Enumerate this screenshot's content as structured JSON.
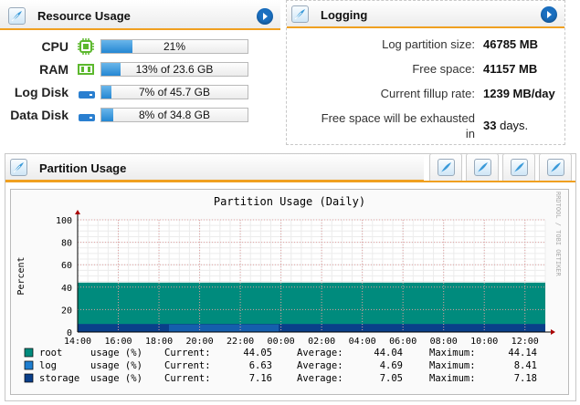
{
  "resource": {
    "title": "Resource Usage",
    "rows": [
      {
        "label": "CPU",
        "icon": "cpu-icon",
        "text": "21%",
        "percent": 21
      },
      {
        "label": "RAM",
        "icon": "ram-icon",
        "text": "13% of 23.6 GB",
        "percent": 13
      },
      {
        "label": "Log Disk",
        "icon": "disk-icon",
        "text": "7% of 45.7 GB",
        "percent": 7
      },
      {
        "label": "Data Disk",
        "icon": "disk-icon",
        "text": "8% of 34.8 GB",
        "percent": 8
      }
    ]
  },
  "logging": {
    "title": "Logging",
    "partition_size_label": "Log partition size:",
    "partition_size_value": "46785 MB",
    "free_space_label": "Free space:",
    "free_space_value": "41157 MB",
    "fillup_label": "Current fillup rate:",
    "fillup_value": "1239 MB/day",
    "exhaust_label_1": "Free space will be exhausted",
    "exhaust_label_2": "in",
    "exhaust_value": "33",
    "exhaust_unit": "days."
  },
  "partition": {
    "title": "Partition Usage"
  },
  "colors": {
    "accent": "#f0a020",
    "root": "#008b7d",
    "log": "#1f7ed0",
    "storage": "#0a3f8a",
    "grid": "#e0a0a0"
  },
  "chart_data": {
    "type": "area",
    "title": "Partition Usage (Daily)",
    "ylabel": "Percent",
    "side_label": "RRDTOOL / TOBI OETIKER",
    "ylim": [
      0,
      100
    ],
    "yticks": [
      "0",
      "20",
      "40",
      "60",
      "80",
      "100"
    ],
    "xticks": [
      "14:00",
      "16:00",
      "18:00",
      "20:00",
      "22:00",
      "00:00",
      "02:00",
      "04:00",
      "06:00",
      "08:00",
      "10:00",
      "12:00"
    ],
    "series": [
      {
        "name": "root",
        "unit": "usage (%)",
        "current": "44.05",
        "average": "44.04",
        "maximum": "44.14",
        "value": 44.05
      },
      {
        "name": "log",
        "unit": "usage (%)",
        "current": "6.63",
        "average": "4.69",
        "maximum": "8.41",
        "value": 6.63
      },
      {
        "name": "storage",
        "unit": "usage (%)",
        "current": "7.16",
        "average": "7.05",
        "maximum": "7.18",
        "value": 7.16
      }
    ],
    "labels": {
      "current": "Current:",
      "average": "Average:",
      "maximum": "Maximum:"
    }
  }
}
